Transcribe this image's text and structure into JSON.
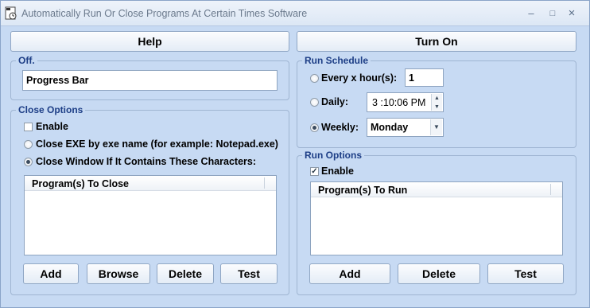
{
  "window": {
    "title": "Automatically Run Or Close Programs At Certain Times Software",
    "minimize": "–",
    "maximize": "□",
    "close": "×"
  },
  "top_buttons": {
    "help": "Help",
    "turn_on": "Turn On"
  },
  "status_group": {
    "legend": "Off.",
    "value": "Progress Bar"
  },
  "close_options": {
    "legend": "Close Options",
    "enable_label": "Enable",
    "enable_checked": false,
    "option_exe_label": "Close EXE by exe name (for example: Notepad.exe)",
    "option_window_label": "Close Window If It Contains These Characters:",
    "selected_option": "window",
    "list_header": "Program(s) To Close",
    "buttons": {
      "add": "Add",
      "browse": "Browse",
      "delete": "Delete",
      "test": "Test"
    }
  },
  "run_schedule": {
    "legend": "Run Schedule",
    "every_label": "Every x hour(s):",
    "every_value": "1",
    "daily_label": "Daily:",
    "daily_time": "3 :10:06 PM",
    "weekly_label": "Weekly:",
    "weekly_value": "Monday",
    "selected_option": "weekly"
  },
  "run_options": {
    "legend": "Run Options",
    "enable_label": "Enable",
    "enable_checked": true,
    "list_header": "Program(s) To Run",
    "buttons": {
      "add": "Add",
      "delete": "Delete",
      "test": "Test"
    }
  },
  "icons": {
    "check_mark": "✓",
    "spin_up": "▲",
    "spin_down": "▼",
    "dropdown": "▼"
  }
}
